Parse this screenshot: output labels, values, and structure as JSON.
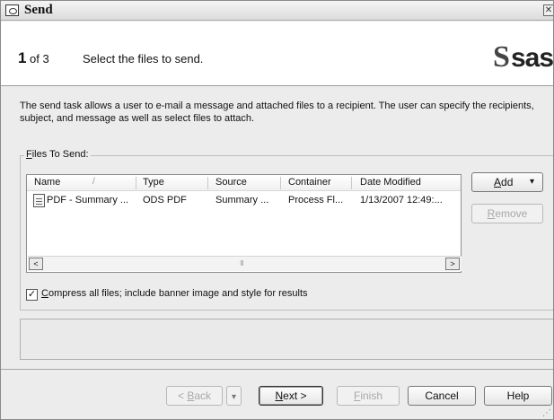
{
  "window": {
    "title": "Send",
    "close_glyph": "✕",
    "title_icon": "window-app-icon"
  },
  "header": {
    "step_number": "1",
    "step_of": "of 3",
    "step_title": "Select the files to send.",
    "logo_text": "sas.",
    "logo_mark": "S"
  },
  "description": "The send task allows a user to e-mail a message and attached files to a recipient.  The user can specify the recipients, subject, and message as well as select files to attach.",
  "files_group": {
    "legend_accel": "F",
    "legend_rest": "iles To Send:",
    "columns": [
      "Name",
      "Type",
      "Source",
      "Container",
      "Date Modified"
    ],
    "sort_indicator": "/",
    "rows": [
      {
        "icon": "pdf-file-icon",
        "name": "PDF - Summary ...",
        "type": "ODS PDF",
        "source": "Summary ...",
        "container": "Process Fl...",
        "date_modified": "1/13/2007 12:49:..."
      }
    ],
    "scroll_left": "<",
    "scroll_right": ">",
    "scroll_grip": "III",
    "add_button": "Add",
    "add_button_accel": "A",
    "add_arrow": "▾",
    "remove_button": "Remove",
    "remove_button_accel": "R"
  },
  "compress": {
    "checked": true,
    "check_mark": "✓",
    "label_accel": "C",
    "label_rest": "ompress all files; include banner image and style for results"
  },
  "footer": {
    "back_label": "< Back",
    "back_dropdown": "▾",
    "next_label": "Next >",
    "finish_label": "Finish",
    "cancel_label": "Cancel",
    "help_label": "Help",
    "resize_grip": "⋰"
  }
}
